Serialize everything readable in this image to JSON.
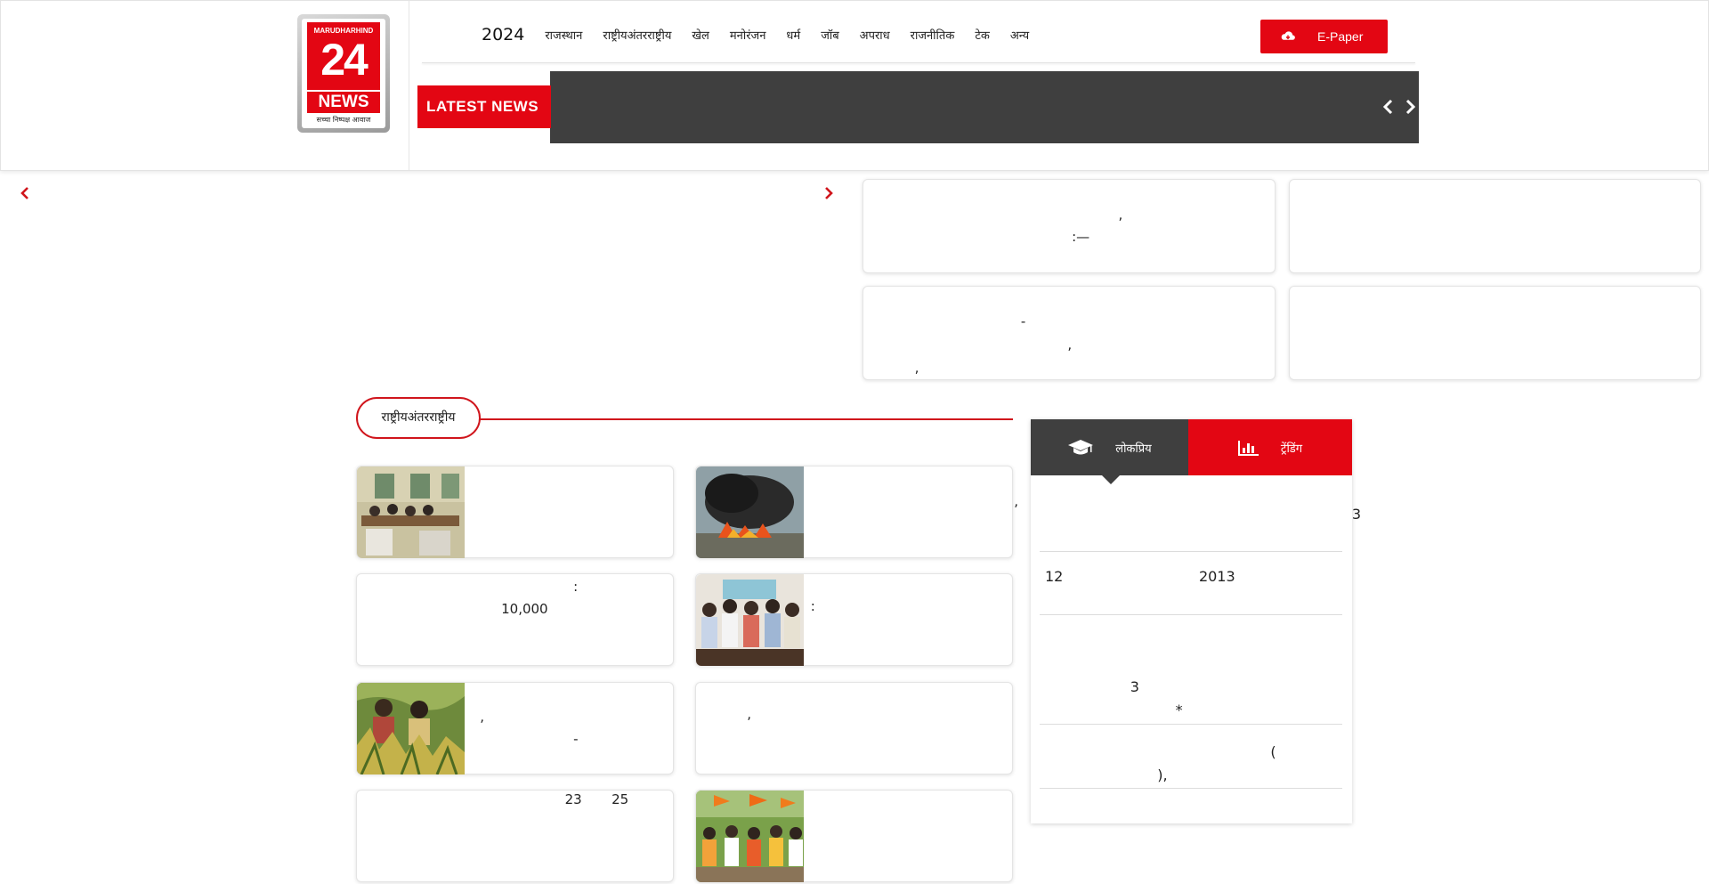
{
  "header": {
    "logo": {
      "brand": "MARUDHARHIND",
      "number": "24",
      "news": "NEWS",
      "tagline": "सच्चा निष्पक्ष आवाज"
    },
    "nav": [
      {
        "label": "2024"
      },
      {
        "label": "राजस्थान"
      },
      {
        "label": "राष्ट्रीयअंतरराष्ट्रीय"
      },
      {
        "label": "खेल"
      },
      {
        "label": "मनोरंजन"
      },
      {
        "label": "धर्म"
      },
      {
        "label": "जॉब"
      },
      {
        "label": "अपराध"
      },
      {
        "label": "राजनीतिक"
      },
      {
        "label": "टेक"
      },
      {
        "label": "अन्य"
      }
    ],
    "epaper_label": "E-Paper",
    "latest_label": "LATEST NEWS"
  },
  "top_cards": [
    {
      "lines": [
        "",
        "                                                          ,",
        "                                               :—"
      ]
    },
    {
      "lines": [
        ""
      ]
    },
    {
      "lines": [
        "                                   -",
        "                                              ,",
        "          ,"
      ]
    },
    {
      "lines": [
        ""
      ]
    }
  ],
  "section": {
    "title": "राष्ट्रीयअंतरराष्ट्रीय"
  },
  "news_cards": [
    {
      "text": ""
    },
    {
      "text": "                ,"
    },
    {
      "text": "                                                   :\n                                  10,000"
    },
    {
      "text": "                           :"
    },
    {
      "text": "                             ,\n                                                   -"
    },
    {
      "text": "            ,"
    },
    {
      "text": "                                                 23       25"
    },
    {
      "text": ""
    }
  ],
  "tabs": {
    "tab_a_label": "लोकप्रिय",
    "tab_b_label": "ट्रेंडिंग",
    "rows": [
      {
        "text": "                                                                     3"
      },
      {
        "text": "12                              2013"
      },
      {
        "text": "                    3\n                              *"
      },
      {
        "text": "                                                   (\n                          ),"
      }
    ]
  },
  "colors": {
    "accent": "#e30613",
    "dark": "#3f3f3f"
  }
}
